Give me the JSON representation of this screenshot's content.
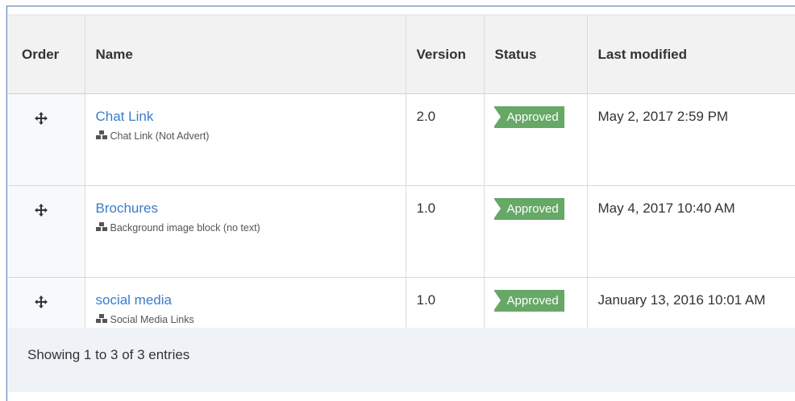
{
  "table": {
    "headers": {
      "order": "Order",
      "name": "Name",
      "version": "Version",
      "status": "Status",
      "modified": "Last modified"
    },
    "rows": [
      {
        "name": "Chat Link",
        "type": "Chat Link (Not Advert)",
        "version": "2.0",
        "status": "Approved",
        "modified": "May 2, 2017 2:59 PM"
      },
      {
        "name": "Brochures",
        "type": "Background image block (no text)",
        "version": "1.0",
        "status": "Approved",
        "modified": "May 4, 2017 10:40 AM"
      },
      {
        "name": "social media",
        "type": "Social Media Links",
        "version": "1.0",
        "status": "Approved",
        "modified": "January 13, 2016 10:01 AM"
      }
    ]
  },
  "footer": {
    "info": "Showing 1 to 3 of 3 entries"
  },
  "colors": {
    "link": "#3a7dc8",
    "approved_badge": "#66a866",
    "header_bg": "#f2f2f2",
    "footer_bg": "#eff3f8"
  },
  "icons": {
    "order_handle": "move-icon",
    "block_type": "cubes-icon"
  }
}
